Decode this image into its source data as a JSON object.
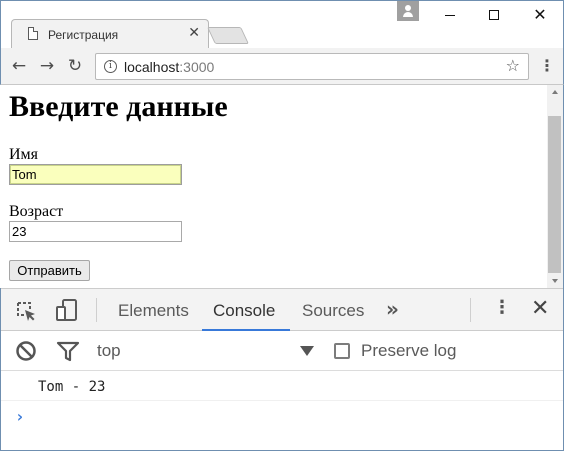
{
  "browser": {
    "tab": {
      "title": "Регистрация",
      "close_glyph": "✕"
    },
    "address": {
      "host": "localhost",
      "port": ":3000"
    },
    "icons": {
      "back": "back-arrow-icon",
      "forward": "forward-arrow-icon",
      "reload": "reload-icon",
      "info": "info-icon",
      "star": "star-icon",
      "menu": "kebab-menu-icon"
    },
    "glyphs": {
      "back": "←",
      "forward": "→",
      "reload": "↻",
      "info": "i",
      "star": "☆",
      "menu": "⋮",
      "close": "✕"
    }
  },
  "page": {
    "heading": "Введите данные",
    "form": {
      "name_label": "Имя",
      "name_value": "Tom",
      "age_label": "Возраст",
      "age_value": "23",
      "submit_label": "Отправить"
    }
  },
  "devtools": {
    "tabs": [
      "Elements",
      "Console",
      "Sources"
    ],
    "active_tab": "Console",
    "more_glyph": "»",
    "menu_glyph": "⋮",
    "close_glyph": "✕",
    "console": {
      "context": "top",
      "preserve_log_label": "Preserve log",
      "preserve_log_checked": false,
      "messages": [
        "Tom - 23"
      ],
      "prompt_glyph": "›"
    }
  },
  "colors": {
    "autofill_bg": "#faffbd",
    "active_tab_underline": "#3879d9",
    "prompt": "#3879d9"
  }
}
